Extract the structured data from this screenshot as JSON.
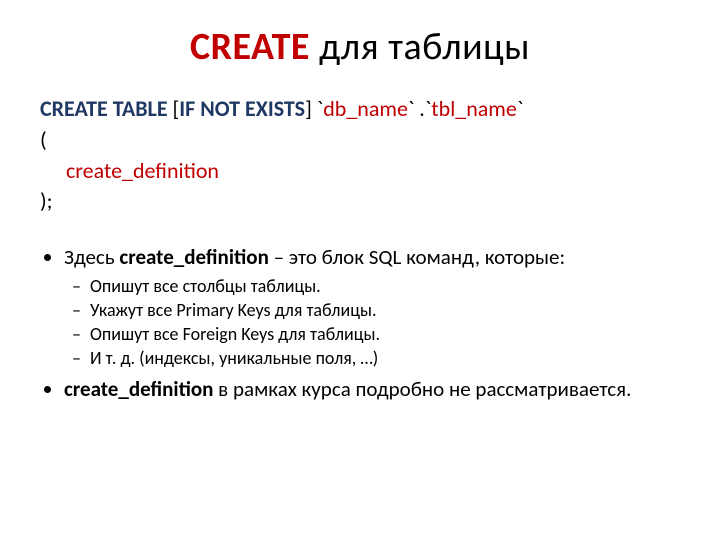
{
  "title": {
    "word1": "CREATE",
    "rest": " для таблицы"
  },
  "syntax": {
    "createTable": "CREATE TABLE ",
    "leftBracket": "[",
    "ifNotExists": "IF NOT EXISTS",
    "rightBracket": "]",
    "tick_db_pre": " `",
    "dbName": "db_name",
    "tick_db_post": "`",
    "dot": " .",
    "tick_tbl_pre": "`",
    "tblName": "tbl_name",
    "tick_tbl_post": "`",
    "openParen": "(",
    "createDef": "create_definition",
    "closeParen": ");"
  },
  "bullets": {
    "b1_prefix": "Здесь ",
    "b1_bold": "create_definition",
    "b1_rest": " – это блок SQL команд, которые:",
    "sub": [
      "Опишут все столбцы таблицы.",
      "Укажут все Primary Keys для таблицы.",
      "Опишут все Foreign Keys для таблицы.",
      "И т. д. (индексы, уникальные поля, …)"
    ],
    "b2_bold": "create_definition",
    "b2_rest": " в рамках курса подробно не рассматривается."
  }
}
